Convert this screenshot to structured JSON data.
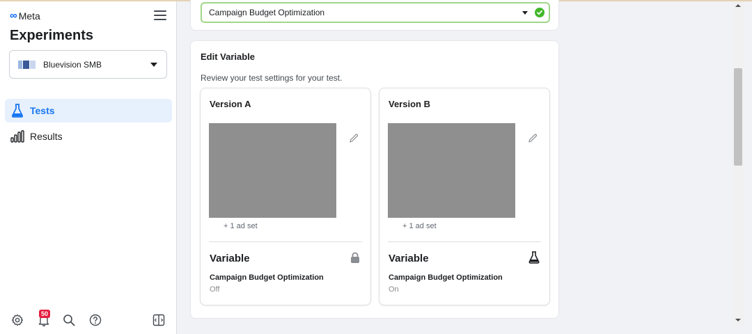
{
  "brand": {
    "name": "Meta",
    "logo_icon": "meta-infinity-icon"
  },
  "sidebar": {
    "title": "Experiments",
    "account": {
      "name": "Bluevision SMB"
    },
    "nav": [
      {
        "label": "Tests",
        "icon": "flask-icon",
        "active": true
      },
      {
        "label": "Results",
        "icon": "bar-chart-icon",
        "active": false
      }
    ],
    "bottom_icons": [
      "gear-icon",
      "bell-icon",
      "search-icon",
      "help-icon",
      "panel-toggle-icon"
    ],
    "notifications_count": "50"
  },
  "top_select": {
    "value": "Campaign Budget Optimization"
  },
  "edit_variable": {
    "title": "Edit Variable",
    "subtitle": "Review your test settings for your test.",
    "versions": [
      {
        "title": "Version A",
        "adset_note": "+ 1 ad set",
        "variable_heading": "Variable",
        "setting": "Campaign Budget Optimization",
        "state": "Off",
        "variable_icon": "lock-icon"
      },
      {
        "title": "Version B",
        "adset_note": "+ 1 ad set",
        "variable_heading": "Variable",
        "setting": "Campaign Budget Optimization",
        "state": "On",
        "variable_icon": "flask-icon"
      }
    ]
  },
  "colors": {
    "accent": "#1877f2",
    "success": "#42b72a",
    "badge": "#e41e3f"
  }
}
